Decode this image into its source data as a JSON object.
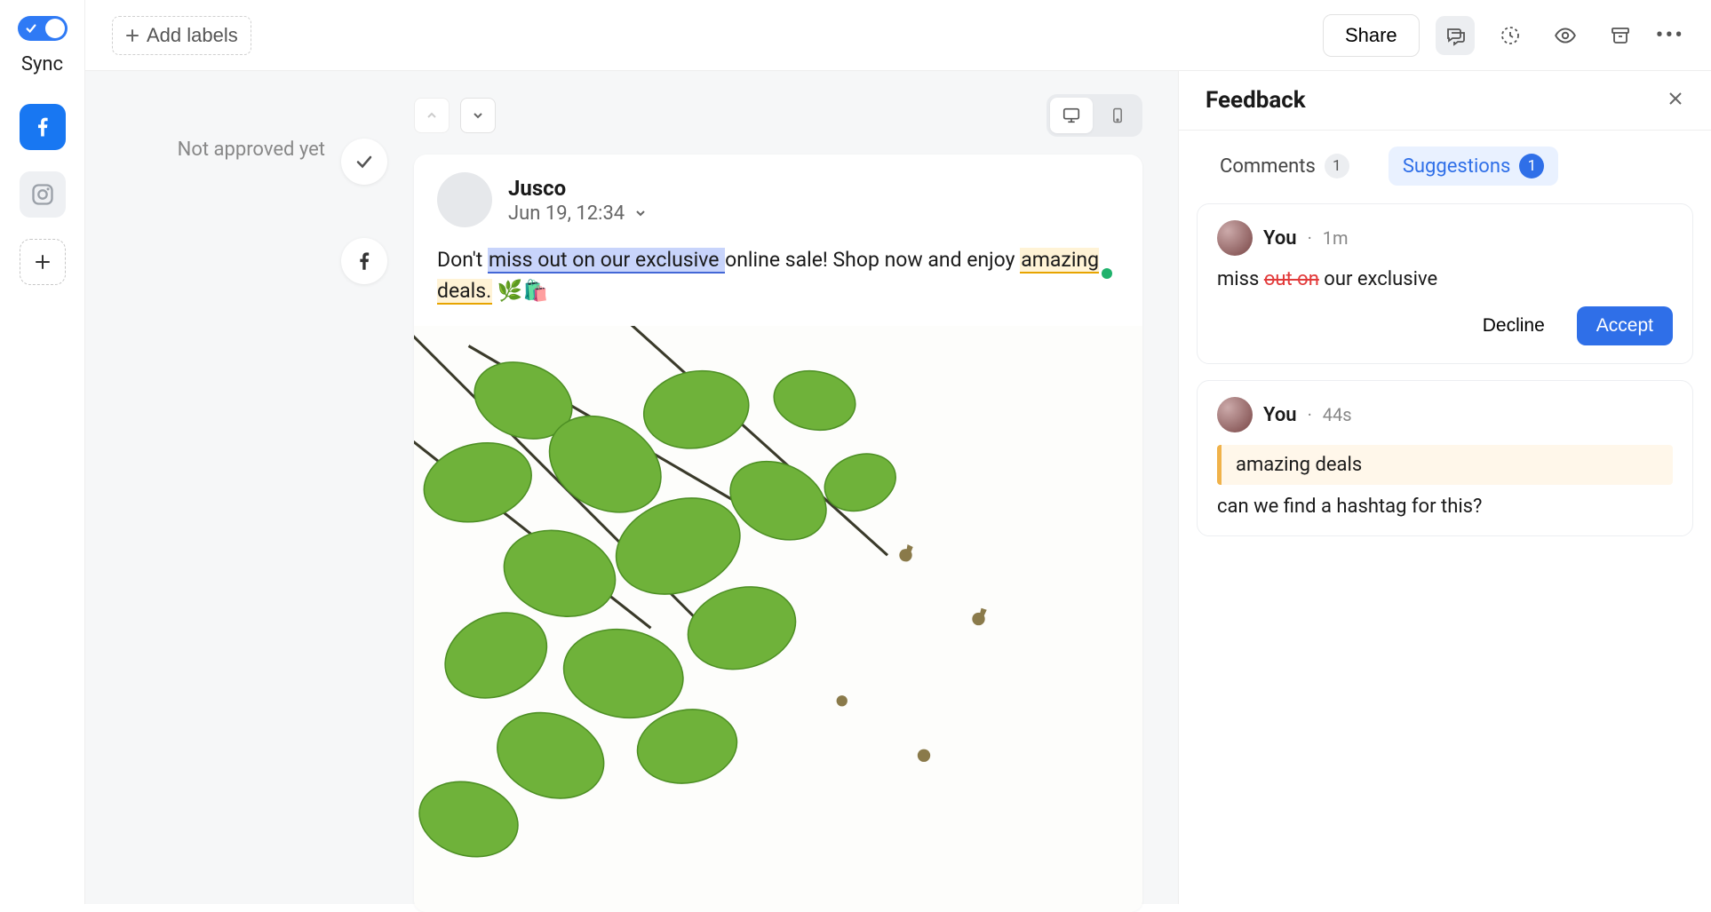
{
  "leftrail": {
    "sync_label": "Sync"
  },
  "topbar": {
    "add_labels": "Add labels",
    "share": "Share"
  },
  "status": {
    "not_approved": "Not approved yet"
  },
  "post": {
    "author": "Jusco",
    "datetime": "Jun 19, 12:34",
    "body_prefix": "Don't ",
    "body_suggested": "miss out on our exclusive ",
    "body_mid": "online sale! Shop now and enjoy ",
    "body_commented": "amazing deals.",
    "body_suffix": " 🌿🛍️"
  },
  "feedback": {
    "title": "Feedback",
    "tabs": {
      "comments_label": "Comments",
      "comments_count": "1",
      "suggestions_label": "Suggestions",
      "suggestions_count": "1"
    },
    "items": [
      {
        "author": "You",
        "time": "1m",
        "suggestion_before": "miss ",
        "suggestion_strike": "out on",
        "suggestion_after": " our exclusive",
        "decline": "Decline",
        "accept": "Accept"
      },
      {
        "author": "You",
        "time": "44s",
        "quote": "amazing deals",
        "comment": "can we find a hashtag for this?"
      }
    ]
  }
}
